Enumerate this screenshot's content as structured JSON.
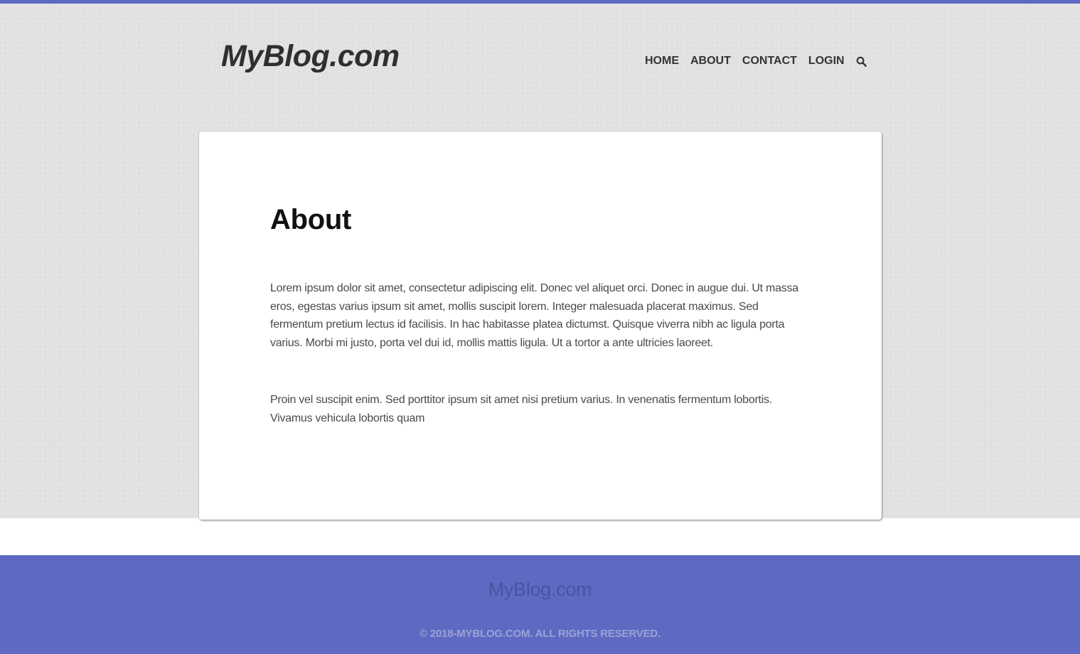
{
  "colors": {
    "accent": "#5e6ac1",
    "hero_background": "#e1e1e1",
    "footer_text": "#9aa1d8"
  },
  "header": {
    "logo": "MyBlog.com",
    "nav": {
      "home": "HOME",
      "about": "ABOUT",
      "contact": "CONTACT",
      "login": "LOGIN",
      "search_icon": "search-icon"
    }
  },
  "main": {
    "title": "About",
    "paragraphs": [
      "Lorem ipsum dolor sit amet, consectetur adipiscing elit. Donec vel aliquet orci. Donec in augue dui. Ut massa eros, egestas varius ipsum sit amet, mollis suscipit lorem. Integer malesuada placerat maximus. Sed fermentum pretium lectus id facilisis. In hac habitasse platea dictumst. Quisque viverra nibh ac ligula porta varius. Morbi mi justo, porta vel dui id, mollis mattis ligula. Ut a tortor a ante ultricies laoreet.",
      "Proin vel suscipit enim. Sed porttitor ipsum sit amet nisi pretium varius. In venenatis fermentum lobortis. Vivamus vehicula lobortis quam"
    ]
  },
  "footer": {
    "logo": "MyBlog.com",
    "copyright": "© 2018-MYBLOG.COM. ALL RIGHTS RESERVED."
  }
}
